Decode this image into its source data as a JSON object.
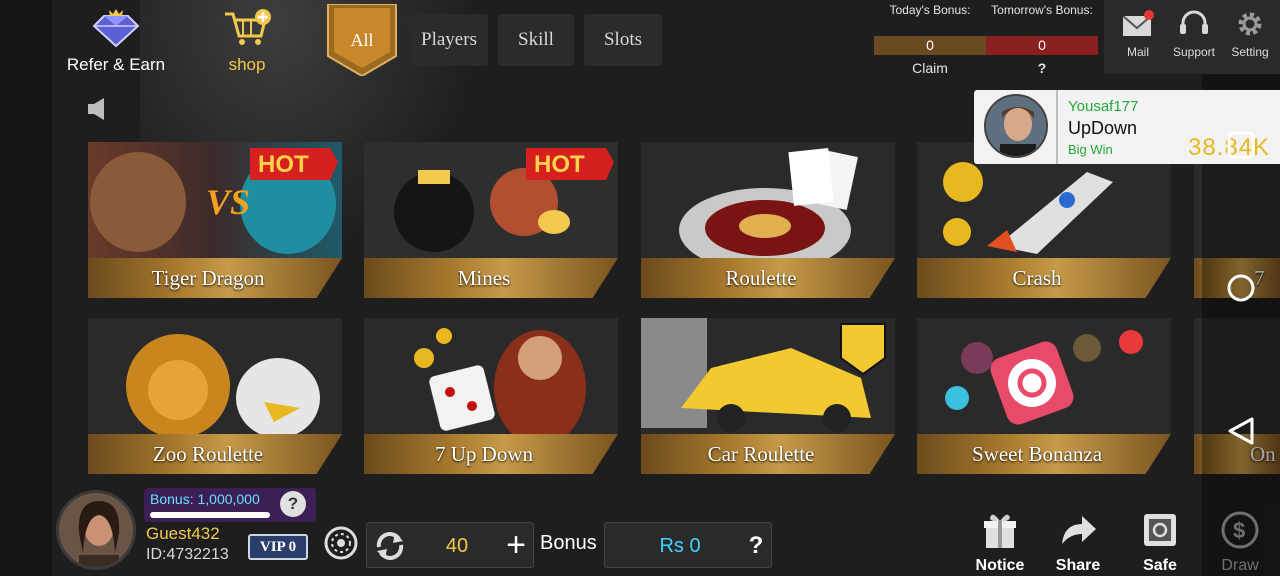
{
  "header": {
    "refer_label": "Refer & Earn",
    "shop_label": "shop",
    "tabs": [
      "All",
      "Players",
      "Skill",
      "Slots"
    ],
    "todays_bonus_label": "Today's Bonus:",
    "tomorrows_bonus_label": "Tomorrow's Bonus:",
    "todays_bonus_value": "0",
    "tomorrows_bonus_value": "0",
    "claim_label": "Claim",
    "help_label": "?",
    "mail_label": "Mail",
    "support_label": "Support",
    "setting_label": "Setting"
  },
  "games": [
    {
      "title": "Tiger Dragon",
      "hot": "HOT"
    },
    {
      "title": "Mines",
      "hot": "HOT"
    },
    {
      "title": "Roulette"
    },
    {
      "title": "Crash"
    },
    {
      "title": "7"
    },
    {
      "title": "Zoo Roulette"
    },
    {
      "title": "7 Up Down"
    },
    {
      "title": "Car Roulette"
    },
    {
      "title": "Sweet Bonanza"
    },
    {
      "title": "On"
    }
  ],
  "popup": {
    "username": "Yousaf177",
    "game": "UpDown",
    "badge": "Big Win",
    "amount": "38.84K"
  },
  "player": {
    "bonus_text": "Bonus: 1,000,000",
    "bonus_help": "?",
    "name": "Guest432",
    "id": "ID:4732213",
    "vip": "VIP 0",
    "coins": "40",
    "plus": "+",
    "bonus_label": "Bonus",
    "rs_value": "Rs 0",
    "rs_help": "?"
  },
  "actions": {
    "notice": "Notice",
    "share": "Share",
    "safe": "Safe",
    "draw": "Draw"
  },
  "colors": {
    "gold": "#f2c94c",
    "band": "#c69a48",
    "cyan": "#3fd3ff",
    "green": "#23a93a"
  }
}
